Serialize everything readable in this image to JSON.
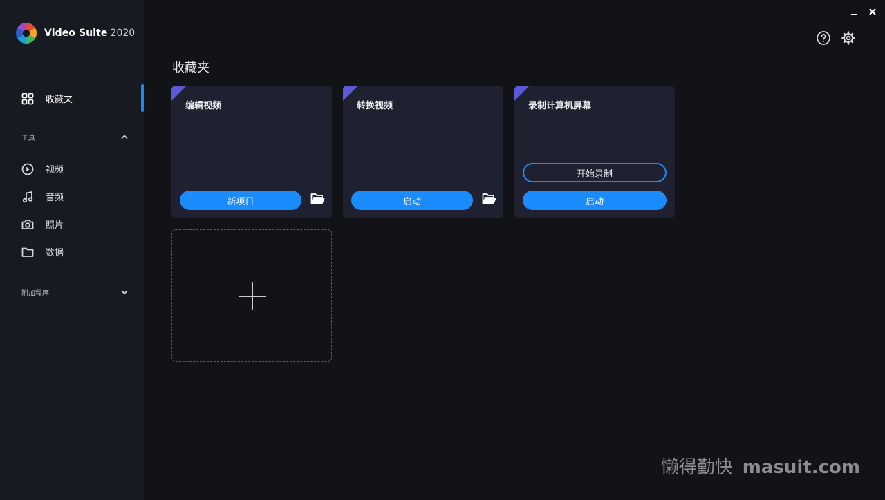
{
  "app": {
    "name": "Video Suite",
    "version": "2020"
  },
  "sidebar": {
    "favorites_label": "收藏夹",
    "tools_section": "工具",
    "tools": [
      {
        "label": "视频",
        "icon": "play-circle-icon"
      },
      {
        "label": "音频",
        "icon": "music-note-icon"
      },
      {
        "label": "照片",
        "icon": "camera-icon"
      },
      {
        "label": "数据",
        "icon": "folder-icon"
      }
    ],
    "addons_section": "附加程序"
  },
  "main": {
    "title": "收藏夹",
    "cards": [
      {
        "title": "编辑视频",
        "primary_label": "新项目"
      },
      {
        "title": "转换视频",
        "primary_label": "启动"
      },
      {
        "title": "录制计算机屏幕",
        "secondary_label": "开始录制",
        "primary_label": "启动"
      }
    ]
  },
  "watermark": {
    "cn": "懒得勤快",
    "url": "masuit.com"
  },
  "colors": {
    "accent": "#1a8cff",
    "background": "#121317",
    "sidebar": "#181a21",
    "card": "#1f2130",
    "corner": "#5b5bd6"
  }
}
